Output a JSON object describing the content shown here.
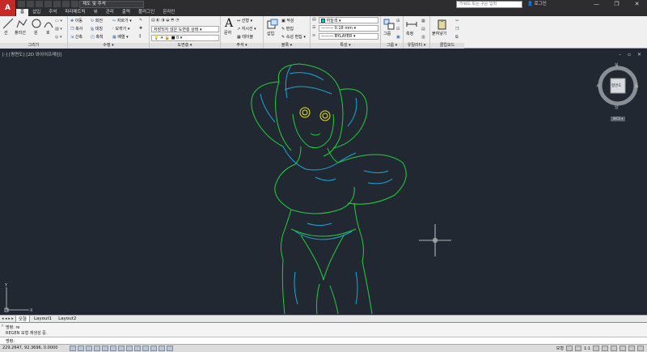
{
  "titlebar": {
    "app_button": "A",
    "workspace": "제도 및 주석",
    "search_placeholder": "키워드 또는 구문 입력",
    "signin": "로그인",
    "minimize": "—",
    "maximize": "❐",
    "close": "✕"
  },
  "tabs": [
    "홈",
    "삽입",
    "주석",
    "파라메트릭",
    "뷰",
    "관리",
    "출력",
    "플러그인",
    "온라인"
  ],
  "ribbon": {
    "draw": {
      "title": "그리기",
      "line": "선",
      "polyline": "폴리선",
      "circle": "원",
      "arc": "호"
    },
    "modify": {
      "title": "수정",
      "move": "이동",
      "rotate": "회전",
      "trim": "자르기",
      "copy": "복사",
      "mirror": "대칭",
      "fillet": "모깎기",
      "stretch": "신축",
      "scale": "축척",
      "array": "배열"
    },
    "layers": {
      "title": "도면층",
      "state": "저장되지 않은 도면층 상태",
      "current": "0"
    },
    "annotation": {
      "title": "주석",
      "text": "문자",
      "dimension": "선형",
      "leader": "지시선",
      "table": "테이블"
    },
    "block": {
      "title": "블록",
      "insert": "삽입",
      "create": "작성",
      "edit": "편집",
      "attr": "속성 편집"
    },
    "properties": {
      "title": "특성",
      "color": "하늘색",
      "lineweight": "0.18 mm",
      "linetype": "BYLAYER"
    },
    "groups": {
      "title": "그룹",
      "group": "그룹"
    },
    "utilities": {
      "title": "유틸리티",
      "measure": "측정"
    },
    "clipboard": {
      "title": "클립보드",
      "paste": "붙여넣기"
    }
  },
  "viewport": {
    "label": "[-] [평면도] [2D 와이어프레임]",
    "controls": "– ▫ ✕",
    "viewcube": {
      "top": "북",
      "bottom": "남",
      "left": "서",
      "right": "동",
      "face": "평면도",
      "wcs": "WCS ▾"
    }
  },
  "layout_tabs": {
    "nav": "◂ ◂ ▸ ▸",
    "tabs": [
      "모형",
      "Layout1",
      "Layout2"
    ]
  },
  "command": {
    "lines": [
      "명령: re",
      "REGEN 모형 재생성 중."
    ],
    "prompt": "명령:"
  },
  "status": {
    "coords": "229.2647, 92.3696, 0.0000",
    "model": "모형",
    "scale": "1:1"
  },
  "colors": {
    "accent_red": "#c62828",
    "viewport_bg": "#212832",
    "line_green": "#1fd13a",
    "line_cyan": "#19a7d8",
    "line_yellow": "#e8e615"
  }
}
